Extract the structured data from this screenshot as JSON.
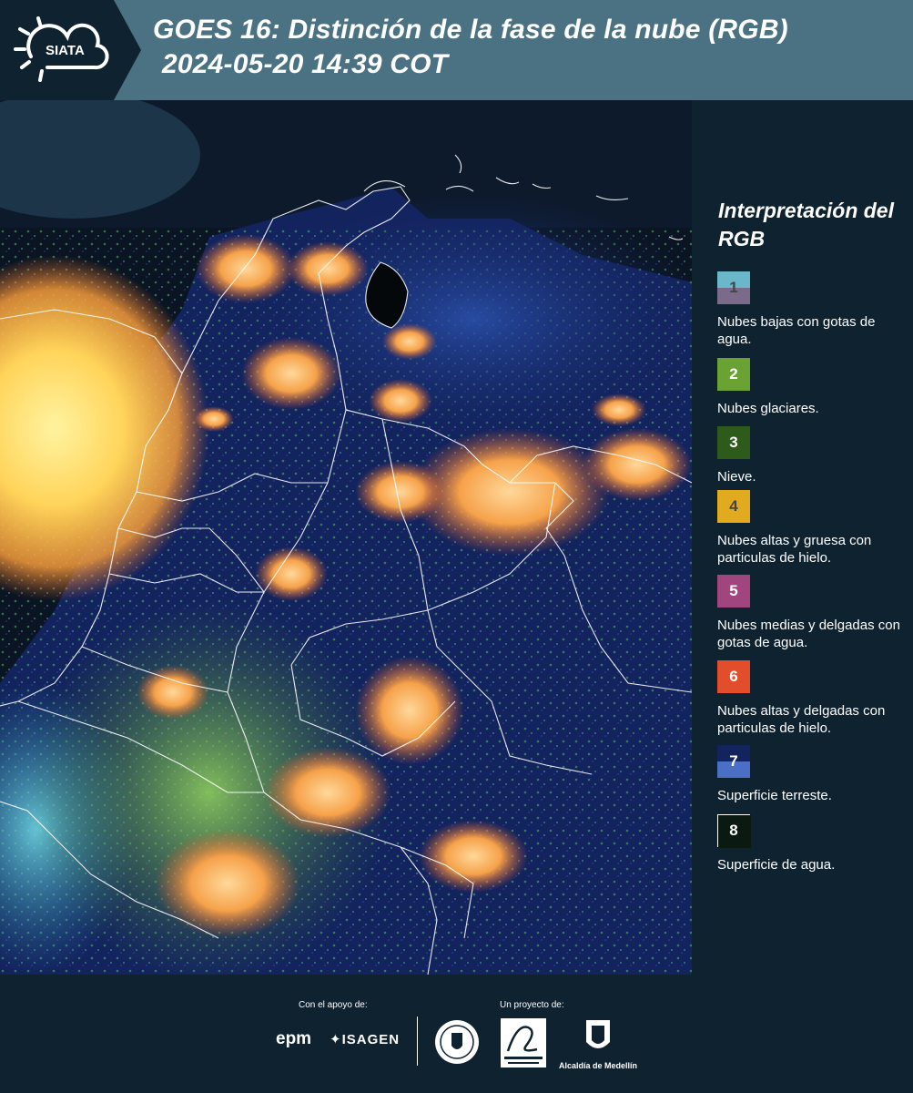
{
  "header": {
    "logo_text": "SIATA",
    "title_line1": "GOES 16: Distinción de la fase de la nube (RGB)",
    "title_line2": "2024-05-20 14:39 COT"
  },
  "legend": {
    "title": "Interpretación del RGB",
    "items": [
      {
        "number": "1",
        "label": "Nubes bajas con gotas de agua.",
        "color_top": "#6ab7c9",
        "color_bottom": "#7b6a8a",
        "number_color": "#444444"
      },
      {
        "number": "2",
        "label": "Nubes glaciares.",
        "color_top": "#6aa334",
        "color_bottom": "#6aa334",
        "number_color": "#ffffff"
      },
      {
        "number": "3",
        "label": "Nieve.",
        "color_top": "#2e5a1c",
        "color_bottom": "#2e5a1c",
        "number_color": "#ffffff"
      },
      {
        "number": "4",
        "label": "Nubes altas y gruesa con particulas de hielo.",
        "color_top": "#e1aa1f",
        "color_bottom": "#e1aa1f",
        "number_color": "#444444"
      },
      {
        "number": "5",
        "label": "Nubes medias y delgadas con gotas de agua.",
        "color_top": "#a0457e",
        "color_bottom": "#a0457e",
        "number_color": "#ffffff"
      },
      {
        "number": "6",
        "label": "Nubes altas y delgadas con particulas de hielo.",
        "color_top": "#e24e2c",
        "color_bottom": "#e24e2c",
        "number_color": "#ffffff"
      },
      {
        "number": "7",
        "label": "Superficie terreste.",
        "color_top": "#13235e",
        "color_bottom": "#4a6fc4",
        "number_color": "#ffffff"
      },
      {
        "number": "8",
        "label": "Superficie de agua.",
        "color_top": "#0a1a10",
        "color_bottom": "#0a1a10",
        "number_color": "#ffffff"
      }
    ]
  },
  "footer": {
    "support_label": "Con el apoyo de:",
    "project_label": "Un proyecto de:",
    "sponsor_1": "epm",
    "sponsor_2": "ISAGEN",
    "partner_3": "Alcaldía de Medellín"
  }
}
